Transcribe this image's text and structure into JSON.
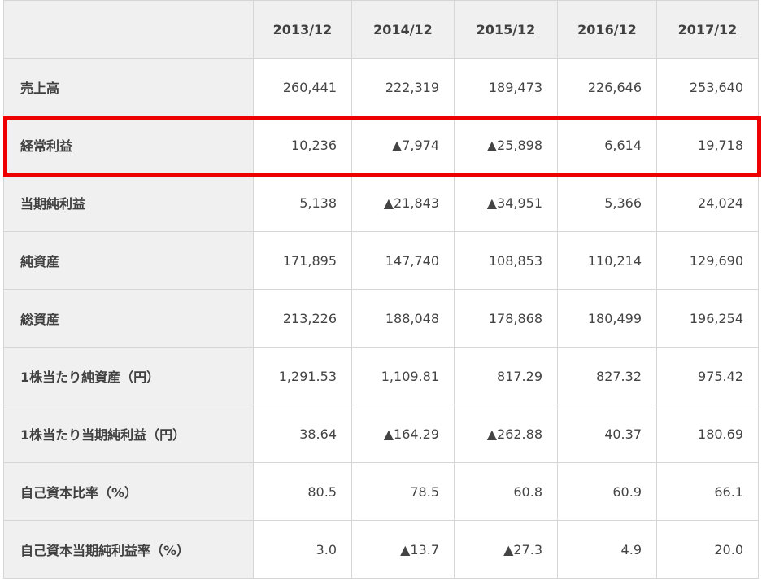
{
  "table": {
    "corner": "",
    "columns": [
      "2013/12",
      "2014/12",
      "2015/12",
      "2016/12",
      "2017/12"
    ],
    "rows": [
      {
        "label": "売上高",
        "values": [
          "260,441",
          "222,319",
          "189,473",
          "226,646",
          "253,640"
        ]
      },
      {
        "label": "経常利益",
        "values": [
          "10,236",
          "▲7,974",
          "▲25,898",
          "6,614",
          "19,718"
        ]
      },
      {
        "label": "当期純利益",
        "values": [
          "5,138",
          "▲21,843",
          "▲34,951",
          "5,366",
          "24,024"
        ]
      },
      {
        "label": "純資産",
        "values": [
          "171,895",
          "147,740",
          "108,853",
          "110,214",
          "129,690"
        ]
      },
      {
        "label": "総資産",
        "values": [
          "213,226",
          "188,048",
          "178,868",
          "180,499",
          "196,254"
        ]
      },
      {
        "label": "1株当たり純資産（円）",
        "values": [
          "1,291.53",
          "1,109.81",
          "817.29",
          "827.32",
          "975.42"
        ]
      },
      {
        "label": "1株当たり当期純利益（円）",
        "values": [
          "38.64",
          "▲164.29",
          "▲262.88",
          "40.37",
          "180.69"
        ]
      },
      {
        "label": "自己資本比率（%）",
        "values": [
          "80.5",
          "78.5",
          "60.8",
          "60.9",
          "66.1"
        ]
      },
      {
        "label": "自己資本当期純利益率（%）",
        "values": [
          "3.0",
          "▲13.7",
          "▲27.3",
          "4.9",
          "20.0"
        ]
      }
    ]
  },
  "highlight": {
    "row_label": "経常利益",
    "color": "#ee0000"
  }
}
